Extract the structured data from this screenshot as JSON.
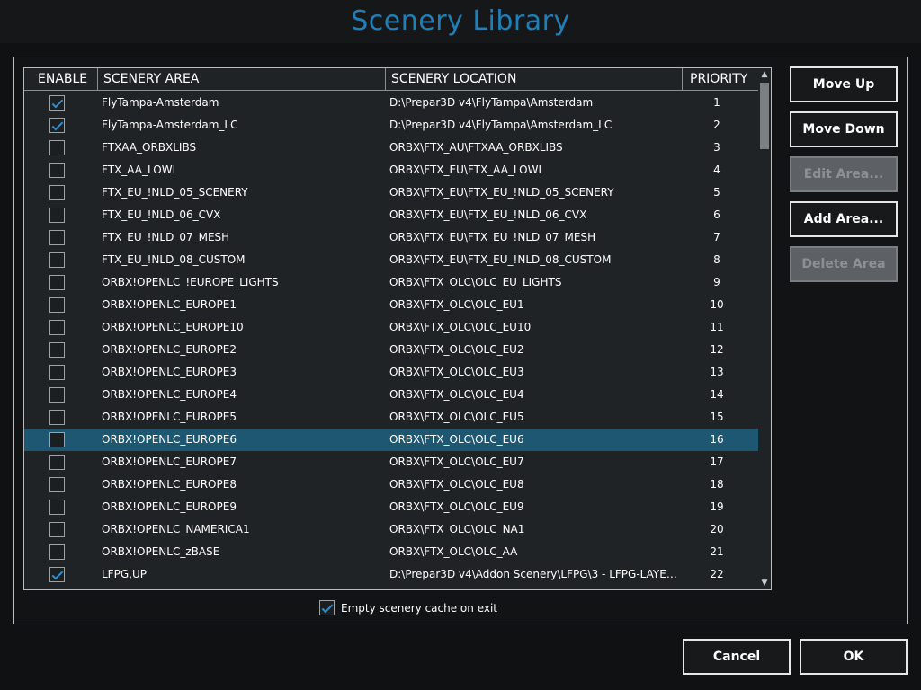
{
  "window": {
    "title": "Scenery Library"
  },
  "table": {
    "columns": {
      "enable": "ENABLE",
      "area": "SCENERY AREA",
      "location": "SCENERY LOCATION",
      "priority": "PRIORITY"
    },
    "selected_priority": "16",
    "rows": [
      {
        "enabled": true,
        "area": "FlyTampa-Amsterdam",
        "location": "D:\\Prepar3D v4\\FlyTampa\\Amsterdam",
        "priority": "1"
      },
      {
        "enabled": true,
        "area": "FlyTampa-Amsterdam_LC",
        "location": "D:\\Prepar3D v4\\FlyTampa\\Amsterdam_LC",
        "priority": "2"
      },
      {
        "enabled": false,
        "area": "FTXAA_ORBXLIBS",
        "location": "ORBX\\FTX_AU\\FTXAA_ORBXLIBS",
        "priority": "3"
      },
      {
        "enabled": false,
        "area": "FTX_AA_LOWI",
        "location": "ORBX\\FTX_EU\\FTX_AA_LOWI",
        "priority": "4"
      },
      {
        "enabled": false,
        "area": "FTX_EU_!NLD_05_SCENERY",
        "location": "ORBX\\FTX_EU\\FTX_EU_!NLD_05_SCENERY",
        "priority": "5"
      },
      {
        "enabled": false,
        "area": "FTX_EU_!NLD_06_CVX",
        "location": "ORBX\\FTX_EU\\FTX_EU_!NLD_06_CVX",
        "priority": "6"
      },
      {
        "enabled": false,
        "area": "FTX_EU_!NLD_07_MESH",
        "location": "ORBX\\FTX_EU\\FTX_EU_!NLD_07_MESH",
        "priority": "7"
      },
      {
        "enabled": false,
        "area": "FTX_EU_!NLD_08_CUSTOM",
        "location": "ORBX\\FTX_EU\\FTX_EU_!NLD_08_CUSTOM",
        "priority": "8"
      },
      {
        "enabled": false,
        "area": "ORBX!OPENLC_!EUROPE_LIGHTS",
        "location": "ORBX\\FTX_OLC\\OLC_EU_LIGHTS",
        "priority": "9"
      },
      {
        "enabled": false,
        "area": "ORBX!OPENLC_EUROPE1",
        "location": "ORBX\\FTX_OLC\\OLC_EU1",
        "priority": "10"
      },
      {
        "enabled": false,
        "area": "ORBX!OPENLC_EUROPE10",
        "location": "ORBX\\FTX_OLC\\OLC_EU10",
        "priority": "11"
      },
      {
        "enabled": false,
        "area": "ORBX!OPENLC_EUROPE2",
        "location": "ORBX\\FTX_OLC\\OLC_EU2",
        "priority": "12"
      },
      {
        "enabled": false,
        "area": "ORBX!OPENLC_EUROPE3",
        "location": "ORBX\\FTX_OLC\\OLC_EU3",
        "priority": "13"
      },
      {
        "enabled": false,
        "area": "ORBX!OPENLC_EUROPE4",
        "location": "ORBX\\FTX_OLC\\OLC_EU4",
        "priority": "14"
      },
      {
        "enabled": false,
        "area": "ORBX!OPENLC_EUROPE5",
        "location": "ORBX\\FTX_OLC\\OLC_EU5",
        "priority": "15"
      },
      {
        "enabled": false,
        "area": "ORBX!OPENLC_EUROPE6",
        "location": "ORBX\\FTX_OLC\\OLC_EU6",
        "priority": "16"
      },
      {
        "enabled": false,
        "area": "ORBX!OPENLC_EUROPE7",
        "location": "ORBX\\FTX_OLC\\OLC_EU7",
        "priority": "17"
      },
      {
        "enabled": false,
        "area": "ORBX!OPENLC_EUROPE8",
        "location": "ORBX\\FTX_OLC\\OLC_EU8",
        "priority": "18"
      },
      {
        "enabled": false,
        "area": "ORBX!OPENLC_EUROPE9",
        "location": "ORBX\\FTX_OLC\\OLC_EU9",
        "priority": "19"
      },
      {
        "enabled": false,
        "area": "ORBX!OPENLC_NAMERICA1",
        "location": "ORBX\\FTX_OLC\\OLC_NA1",
        "priority": "20"
      },
      {
        "enabled": false,
        "area": "ORBX!OPENLC_zBASE",
        "location": "ORBX\\FTX_OLC\\OLC_AA",
        "priority": "21"
      },
      {
        "enabled": true,
        "area": "LFPG,UP",
        "location": "D:\\Prepar3D v4\\Addon Scenery\\LFPG\\3 - LFPG-LAYER...",
        "priority": "22"
      }
    ]
  },
  "buttons": {
    "move_up": "Move Up",
    "move_down": "Move Down",
    "edit_area": "Edit Area...",
    "add_area": "Add Area...",
    "delete_area": "Delete Area",
    "cancel": "Cancel",
    "ok": "OK"
  },
  "cache": {
    "label": "Empty scenery cache on exit",
    "checked": true
  },
  "icons": {
    "check": "checkmark-icon",
    "scroll_up": "scroll-up-arrow-icon",
    "scroll_down": "scroll-down-arrow-icon"
  },
  "colors": {
    "accent": "#1f7fb6",
    "selection": "#1d5772",
    "disabled_button": "#5d6165"
  }
}
